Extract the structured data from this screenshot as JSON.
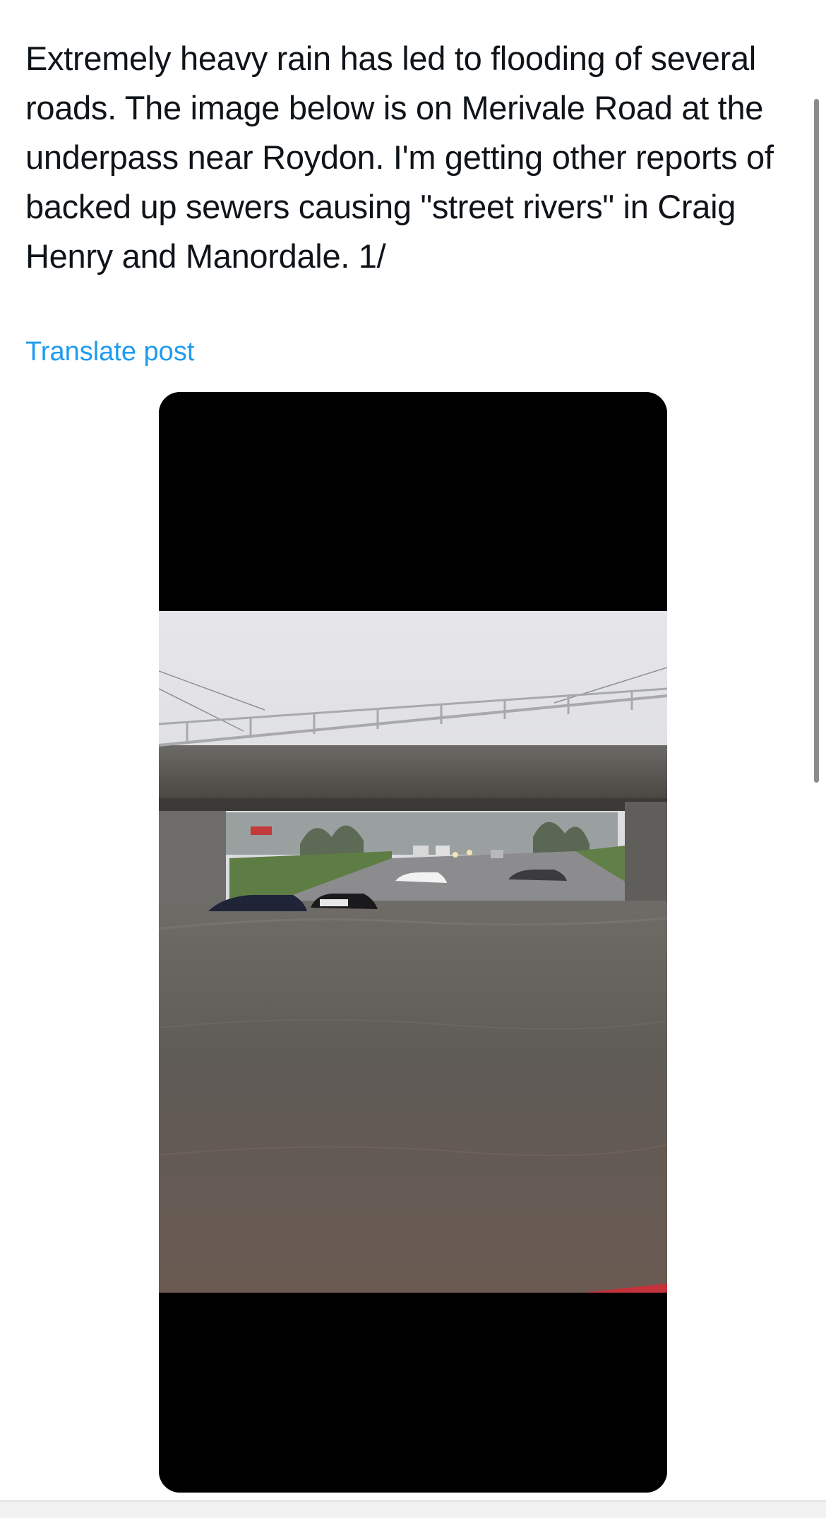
{
  "post": {
    "text": "Extremely heavy rain has led to flooding of several roads. The image below is on Merivale Road at the underpass near Roydon. I'm getting other reports of backed up sewers causing \"street rivers\" in Craig Henry and Manordale. 1/",
    "translate_label": "Translate post"
  },
  "media": {
    "icon": "photo-flooded-underpass"
  },
  "colors": {
    "text": "#0f1419",
    "link": "#1d9bf0",
    "background": "#ffffff",
    "media_letterbox": "#000000"
  }
}
